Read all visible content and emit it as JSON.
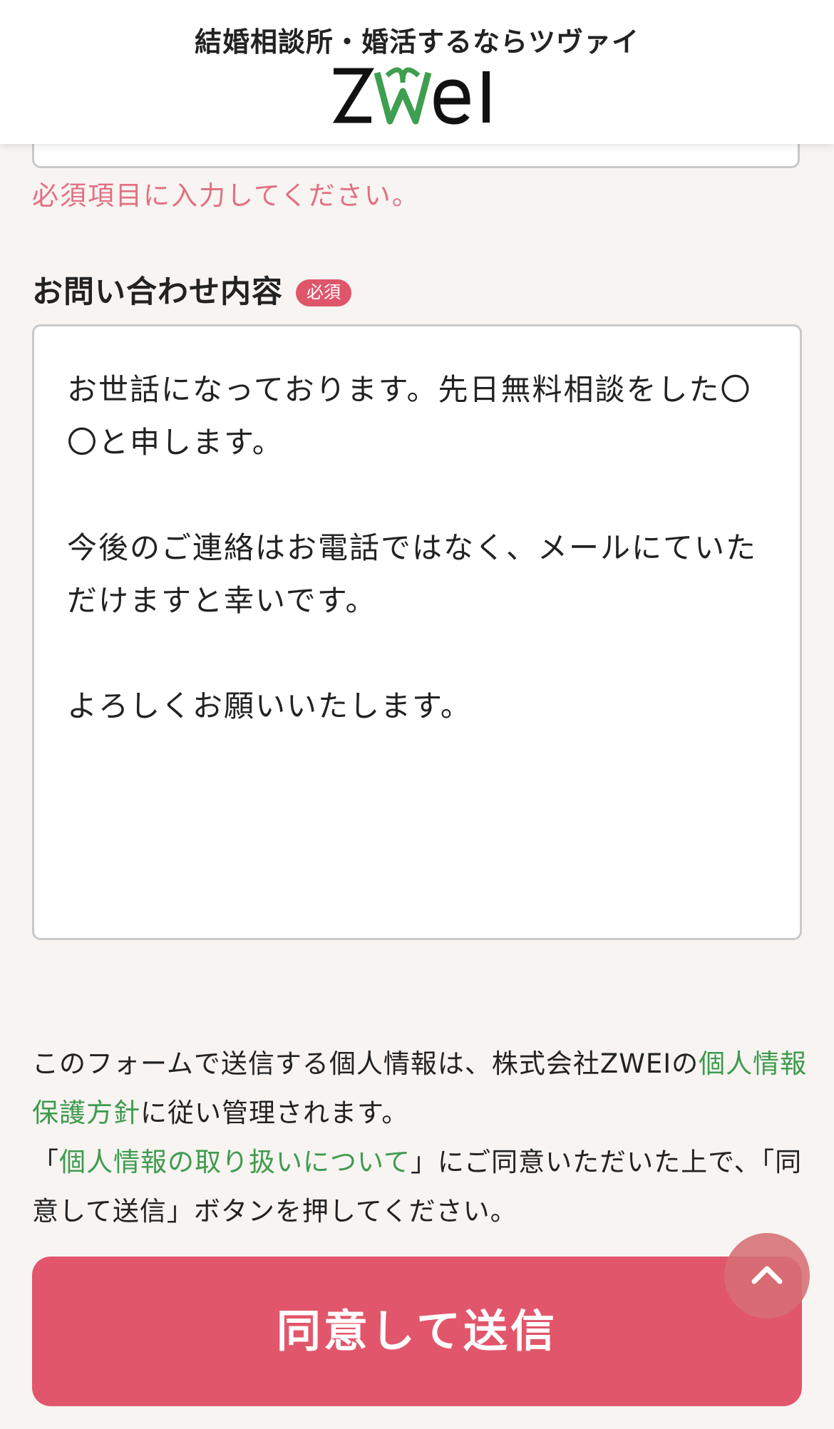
{
  "header": {
    "tagline": "結婚相談所・婚活するならツヴァイ",
    "logo_text": "ZWEI",
    "logo_colors": {
      "text": "#111111",
      "heart": "#3f9e4f"
    }
  },
  "previous_field": {
    "error": "必須項目に入力してください。"
  },
  "inquiry": {
    "label": "お問い合わせ内容",
    "required_badge": "必須",
    "value": "お世話になっております。先日無料相談をした〇〇と申します。\n\n今後のご連絡はお電話ではなく、メールにていただけますと幸いです。\n\nよろしくお願いいたします。"
  },
  "consent": {
    "text1": "このフォームで送信する個人情報は、株式会社ZWEIの",
    "link1": "個人情報保護方針",
    "text2": "に従い管理されます。",
    "text3": "「",
    "link2": "個人情報の取り扱いについて",
    "text4": "」にご同意いただいた上で、「同意して送信」ボタンを押してください。"
  },
  "submit_label": "同意して送信",
  "scroll_top_icon": "chevron-up-icon",
  "colors": {
    "accent": "#e2566b",
    "error": "#e36f82",
    "link": "#3e9b4d",
    "background": "#f7f4f2"
  }
}
